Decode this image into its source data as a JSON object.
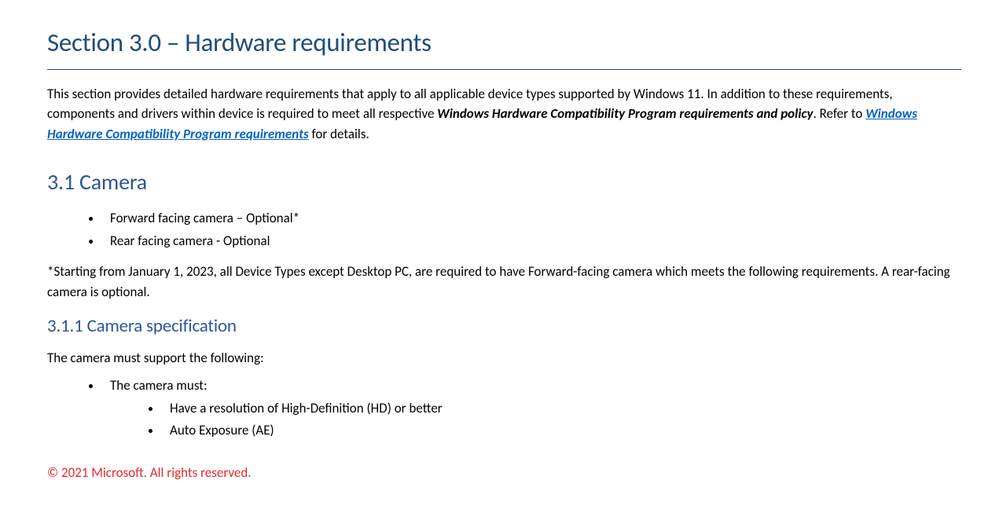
{
  "section": {
    "title": "Section 3.0 – Hardware requirements",
    "intro": {
      "part1": "This section provides detailed hardware requirements that apply to all applicable device types supported by Windows 11. In addition to these requirements, components and drivers within device is required to meet all respective ",
      "bold_italic1": "Windows Hardware Compatibility Program requirements and policy",
      "part2": ". Refer to ",
      "link_text": "Windows Hardware Compatibility Program requirements",
      "part3": " for details."
    }
  },
  "sub31": {
    "title": "3.1 Camera",
    "items": [
      "Forward facing camera – Optional*",
      "Rear facing camera - Optional"
    ],
    "note": "*Starting from January 1, 2023, all Device Types except Desktop PC, are required to have Forward-facing camera which meets the following requirements. A rear-facing camera is optional."
  },
  "sub311": {
    "title": "3.1.1 Camera specification",
    "lead": "The camera must support the following:",
    "item0": "The camera must:",
    "subitems": [
      "Have a resolution of High-Definition (HD) or better",
      "Auto Exposure (AE)"
    ]
  },
  "footer": {
    "copyright": "© 2021 Microsoft. All rights reserved."
  }
}
